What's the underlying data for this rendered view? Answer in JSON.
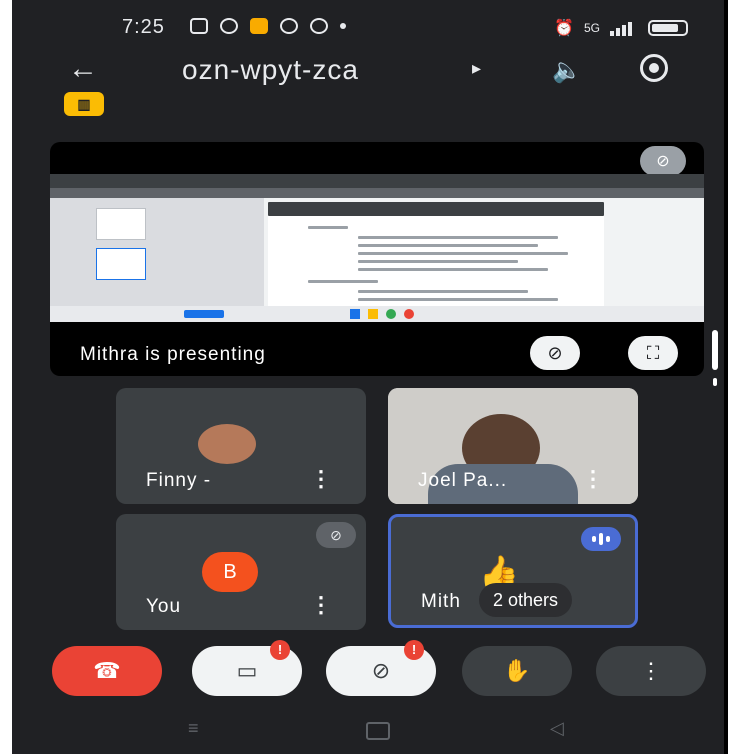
{
  "status_bar": {
    "time": "7:25",
    "network": "5G"
  },
  "header": {
    "meeting_code": "ozn-wpyt-zca",
    "caret": "▸",
    "back_icon": "back-arrow-icon",
    "audio_icon": "speaker-icon",
    "flip_icon": "switch-camera-icon"
  },
  "badge": {
    "label": "🏢",
    "icon": "building-icon"
  },
  "presentation": {
    "caption": "Mithra is presenting",
    "pin_icon": "pin-off-icon",
    "fullscreen_icon": "fullscreen-icon",
    "mute_icon": "mic-off-icon"
  },
  "participants": [
    {
      "name": "Finny -",
      "more": "⋮"
    },
    {
      "name": "Joel Pa...",
      "more": "⋮"
    },
    {
      "name": "You",
      "initial": "B",
      "more": "⋮"
    },
    {
      "name": "Mith",
      "others": "2 others"
    }
  ],
  "controls": {
    "end_call_icon": "end-call-icon",
    "camera_icon": "camera-off-icon",
    "mic_icon": "mic-off-icon",
    "raise_hand_icon": "raise-hand-icon",
    "more_icon": "more-vertical-icon",
    "alert_mark": "!",
    "more_glyph": "⋮"
  },
  "colors": {
    "background": "#202124",
    "tile": "#3c4043",
    "end_call": "#ea4335",
    "avatar_you": "#f4511e",
    "badge": "#fbbc04",
    "speaking": "#4a6cd4"
  }
}
